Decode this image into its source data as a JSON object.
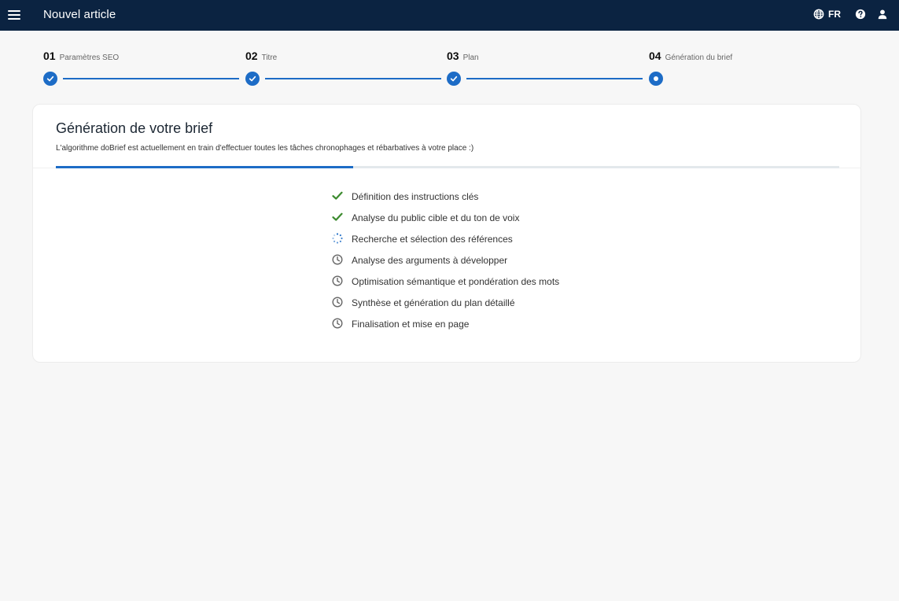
{
  "header": {
    "title": "Nouvel article",
    "language": "FR",
    "icons": [
      "menu-icon",
      "globe-icon",
      "help-icon",
      "user-icon"
    ]
  },
  "stepper": {
    "steps": [
      {
        "number": "01",
        "label": "Paramètres SEO",
        "status": "done"
      },
      {
        "number": "02",
        "label": "Titre",
        "status": "done"
      },
      {
        "number": "03",
        "label": "Plan",
        "status": "done"
      },
      {
        "number": "04",
        "label": "Génération du brief",
        "status": "current"
      }
    ]
  },
  "card": {
    "title": "Génération de votre brief",
    "subtitle": "L'algorithme doBrief est actuellement en train d'effectuer toutes les tâches chronophages et rébarbatives à votre place :)",
    "progress_percent": 38
  },
  "tasks": [
    {
      "label": "Définition des instructions clés",
      "status": "done"
    },
    {
      "label": "Analyse du public cible et du ton de voix",
      "status": "done"
    },
    {
      "label": "Recherche et sélection des références",
      "status": "in-progress"
    },
    {
      "label": "Analyse des arguments à développer",
      "status": "pending"
    },
    {
      "label": "Optimisation sémantique et pondération des mots",
      "status": "pending"
    },
    {
      "label": "Synthèse et génération du plan détaillé",
      "status": "pending"
    },
    {
      "label": "Finalisation et mise en page",
      "status": "pending"
    }
  ],
  "colors": {
    "header_bg": "#0b2341",
    "accent": "#1d6cc6",
    "done_check": "#3b8a2e",
    "pending_icon": "#666666"
  }
}
